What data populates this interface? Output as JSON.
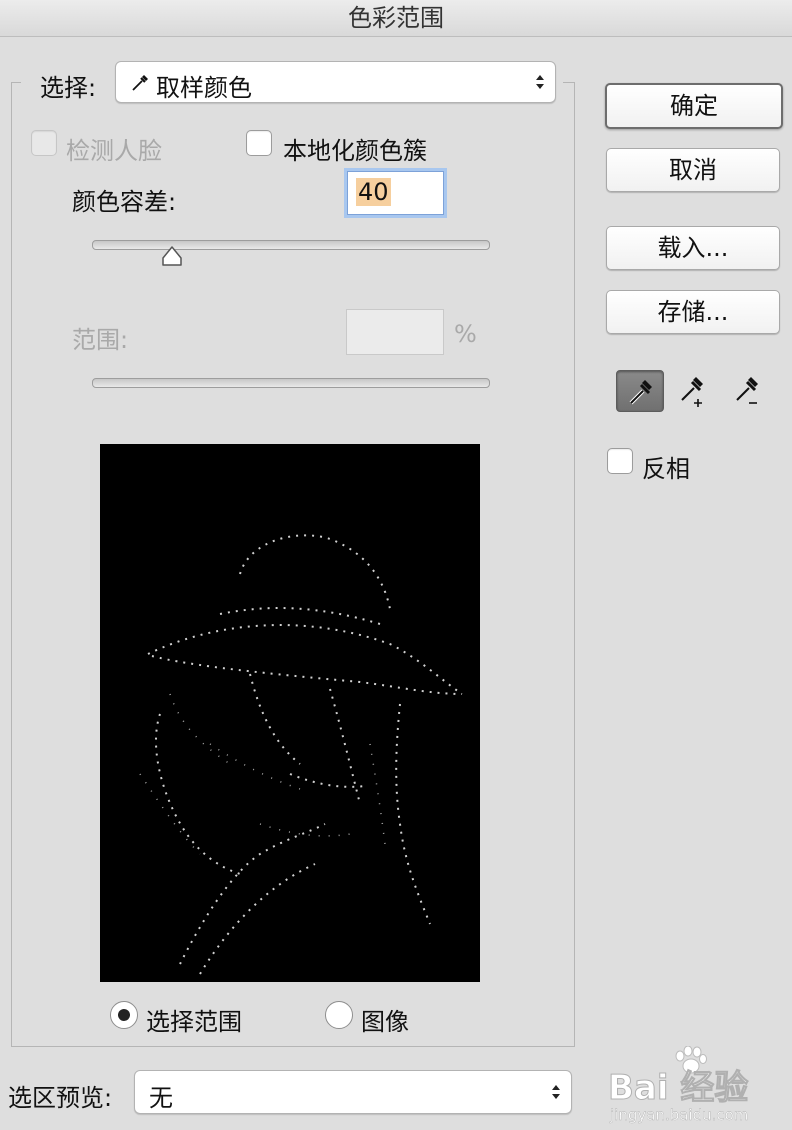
{
  "window": {
    "title": "色彩范围"
  },
  "select_row": {
    "label": "选择:",
    "value": "取样颜色",
    "icon": "eyedropper-icon"
  },
  "options": {
    "detect_faces": {
      "label": "检测人脸",
      "checked": false,
      "enabled": false
    },
    "localized_clusters": {
      "label": "本地化颜色簇",
      "checked": false,
      "enabled": true
    }
  },
  "fuzziness": {
    "label": "颜色容差:",
    "value": "40",
    "slider_level": 0.2
  },
  "range": {
    "label": "范围:",
    "value": "",
    "unit": "%",
    "enabled": false
  },
  "view_mode": {
    "selection": {
      "label": "选择范围",
      "selected": true
    },
    "image": {
      "label": "图像",
      "selected": false
    }
  },
  "preview_row": {
    "label": "选区预览:",
    "value": "无"
  },
  "buttons": {
    "ok": "确定",
    "cancel": "取消",
    "load": "载入...",
    "save": "存储..."
  },
  "tools": [
    "eyedropper-icon",
    "eyedropper-plus-icon",
    "eyedropper-minus-icon"
  ],
  "invert": {
    "label": "反相",
    "checked": false
  },
  "watermark": {
    "text": "Bai 经验",
    "url": "jingyan.baidu.com"
  },
  "colors": {
    "focus_ring": "#a8c7ef",
    "value_highlight": "#f6cf9e",
    "dialog_bg": "#dedede"
  }
}
